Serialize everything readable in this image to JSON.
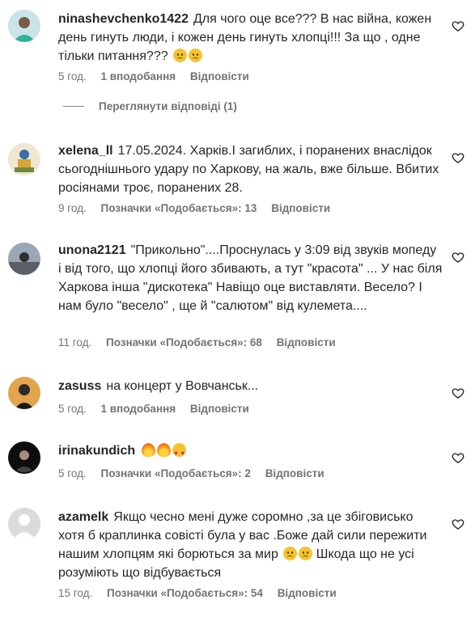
{
  "comments": [
    {
      "username": "ninashevchenko1422",
      "text": "Для чого оце все??? В нас війна, кожен день гинуть люди, і кожен день гинуть хлопці!!! За що , одне тільки питання???",
      "time": "5 год.",
      "likes": "1 вподобання",
      "reply": "Відповісти",
      "view_replies": "Переглянути відповіді (1)"
    },
    {
      "username": "xelena_ll",
      "text": "17.05.2024. Харків.І загиблих, і поранених внаслідок сьогоднішнього удару по Харкову, на жаль, вже більше. Вбитих росіянами троє, поранених 28.",
      "time": "9 год.",
      "likes": "Позначки «Подобається»: 13",
      "reply": "Відповісти"
    },
    {
      "username": "unona2121",
      "text": "\"Прикольно\"....Проснулась у 3:09 від звуків мопеду і від того, що хлопці його збивають, а тут \"красота\" ... У нас біля Харкова інша \"дискотека\" Навіщо оце виставляти. Весело? І нам було \"весело\" , ще й \"салютом\" від кулемета....",
      "time": "11 год.",
      "likes": "Позначки «Подобається»: 68",
      "reply": "Відповісти"
    },
    {
      "username": "zasuss",
      "text": "на концерт у Вовчанськ...",
      "time": "5 год.",
      "likes": "1 вподобання",
      "reply": "Відповісти"
    },
    {
      "username": "irinakundich",
      "text": "",
      "time": "5 год.",
      "likes": "Позначки «Подобається»: 2",
      "reply": "Відповісти"
    },
    {
      "username": "azamelk",
      "text_a": "Якщо чесно мені дуже соромно ,за це збіговисько хотя б краплинка совісті була у вас .Боже дай сили пережити нашим хлопцям які борються за мир",
      "text_b": "Шкода що не усі розуміють що відбувається",
      "time": "15 год.",
      "likes": "Позначки «Подобається»: 54",
      "reply": "Відповісти"
    }
  ],
  "icons": {
    "like": "heart-outline-icon",
    "sad": "sad-face-emoji",
    "fire": "fire-emoji",
    "heart_eyes": "heart-eyes-emoji"
  }
}
